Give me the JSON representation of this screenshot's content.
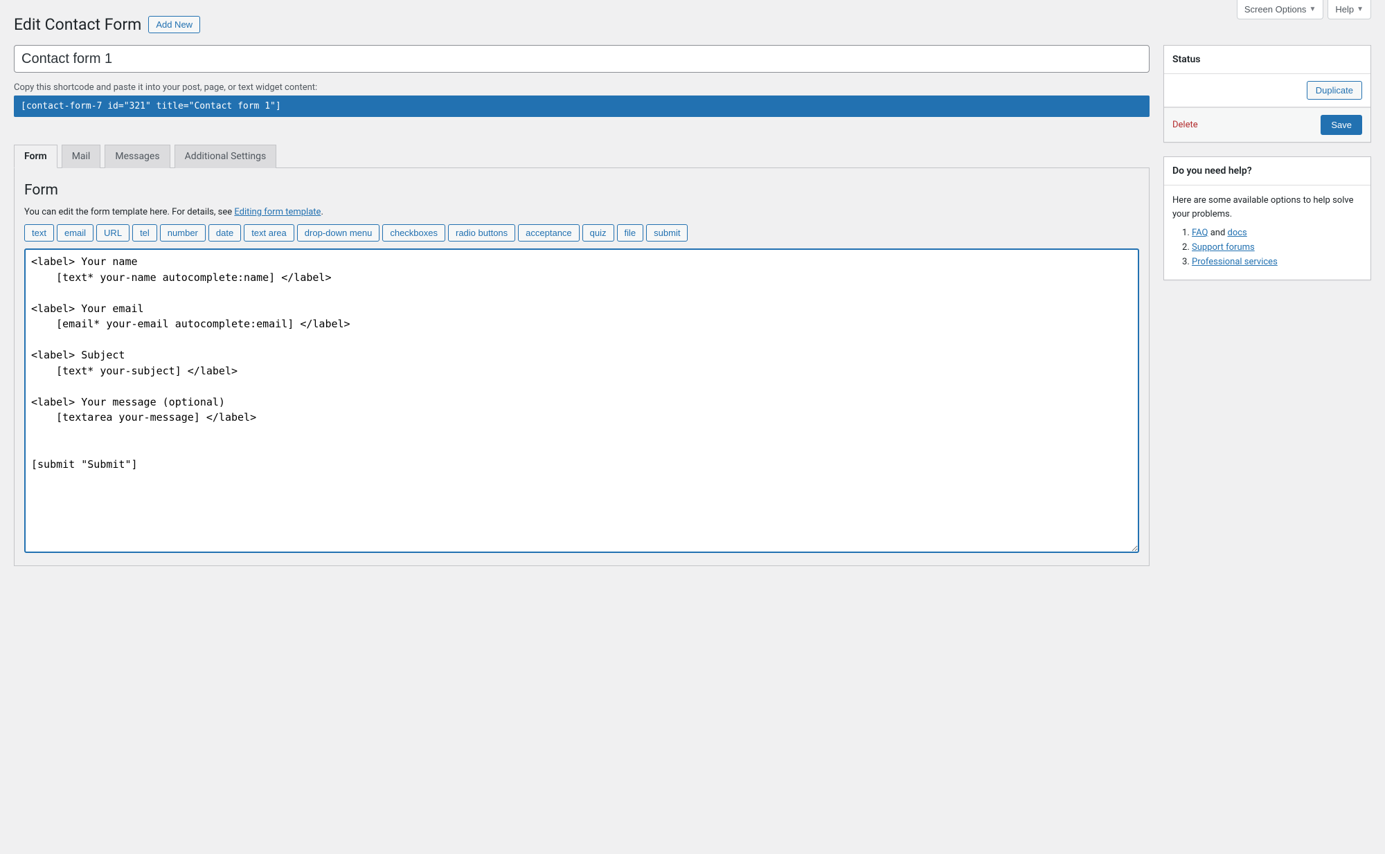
{
  "topButtons": {
    "screenOptions": "Screen Options",
    "help": "Help"
  },
  "header": {
    "title": "Edit Contact Form",
    "addNew": "Add New"
  },
  "form": {
    "titleValue": "Contact form 1",
    "shortcodeHint": "Copy this shortcode and paste it into your post, page, or text widget content:",
    "shortcode": "[contact-form-7 id=\"321\" title=\"Contact form 1\"]"
  },
  "tabs": [
    "Form",
    "Mail",
    "Messages",
    "Additional Settings"
  ],
  "formPanel": {
    "heading": "Form",
    "descPrefix": "You can edit the form template here. For details, see ",
    "descLink": "Editing form template",
    "descSuffix": ".",
    "tagButtons": [
      "text",
      "email",
      "URL",
      "tel",
      "number",
      "date",
      "text area",
      "drop-down menu",
      "checkboxes",
      "radio buttons",
      "acceptance",
      "quiz",
      "file",
      "submit"
    ],
    "textarea": "<label> Your name\n    [text* your-name autocomplete:name] </label>\n\n<label> Your email\n    [email* your-email autocomplete:email] </label>\n\n<label> Subject\n    [text* your-subject] </label>\n\n<label> Your message (optional)\n    [textarea your-message] </label>\n\n\n[submit \"Submit\"]"
  },
  "statusBox": {
    "title": "Status",
    "duplicate": "Duplicate",
    "delete": "Delete",
    "save": "Save"
  },
  "helpBox": {
    "title": "Do you need help?",
    "intro": "Here are some available options to help solve your problems.",
    "faq": "FAQ",
    "and": " and ",
    "docs": "docs",
    "supportForums": "Support forums",
    "professional": "Professional services"
  }
}
